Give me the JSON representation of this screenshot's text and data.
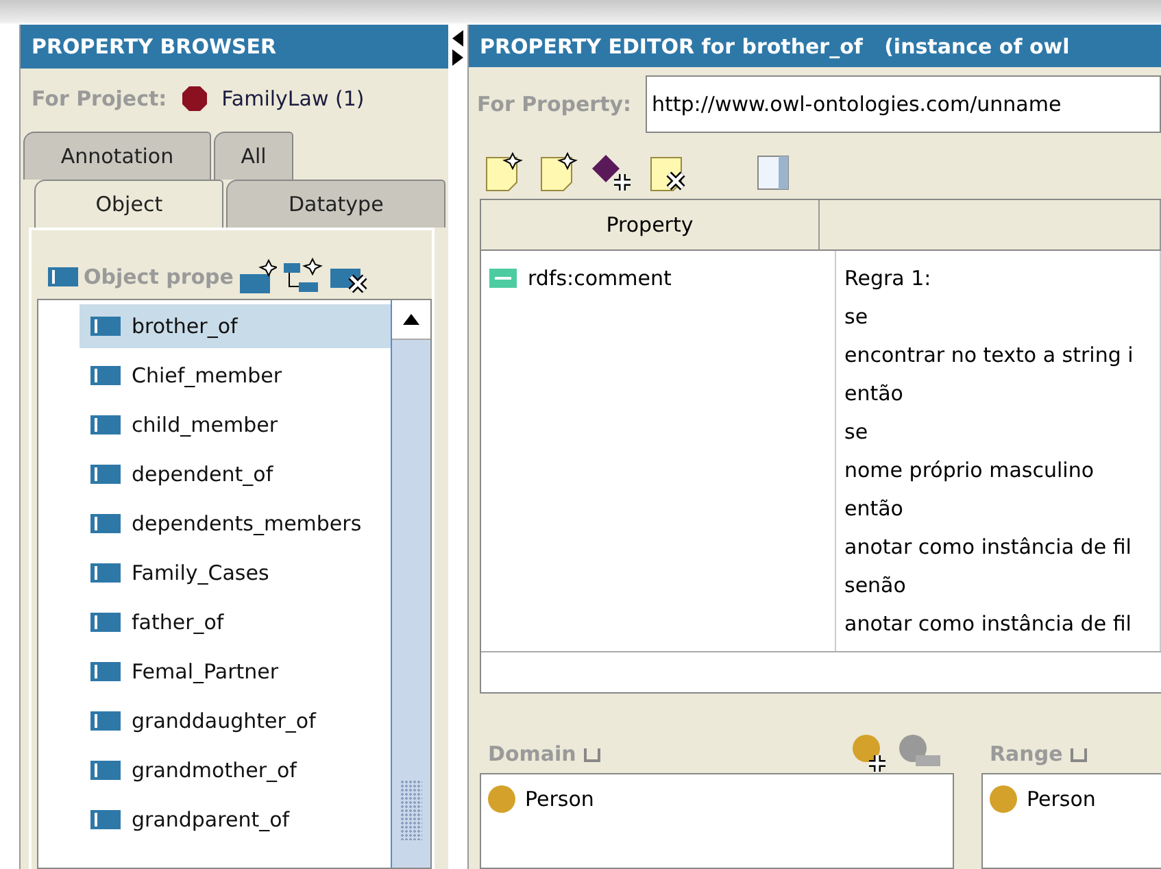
{
  "browser": {
    "title": "PROPERTY BROWSER",
    "project_label": "For Project:",
    "project": "FamilyLaw (1)",
    "tab_rows": [
      {
        "tabs": [
          {
            "label": "Annotation",
            "selected": false
          },
          {
            "label": "All",
            "selected": false
          }
        ]
      },
      {
        "tabs": [
          {
            "label": "Object",
            "selected": true
          },
          {
            "label": "Datatype",
            "selected": false
          }
        ]
      }
    ],
    "list_title": "Object prope",
    "items": [
      {
        "label": "brother_of",
        "selected": true
      },
      {
        "label": "Chief_member",
        "selected": false
      },
      {
        "label": "child_member",
        "selected": false
      },
      {
        "label": "dependent_of",
        "selected": false
      },
      {
        "label": "dependents_members",
        "selected": false
      },
      {
        "label": "Family_Cases",
        "selected": false
      },
      {
        "label": "father_of",
        "selected": false
      },
      {
        "label": "Femal_Partner",
        "selected": false
      },
      {
        "label": "granddaughter_of",
        "selected": false
      },
      {
        "label": "grandmother_of",
        "selected": false
      },
      {
        "label": "grandparent_of",
        "selected": false
      }
    ]
  },
  "editor": {
    "title": "PROPERTY EDITOR for brother_of   (instance of owl",
    "property_label": "For Property:",
    "property_uri": "http://www.owl-ontologies.com/unname",
    "table": {
      "columns": [
        "Property"
      ],
      "rows": [
        {
          "property": "rdfs:comment",
          "value_lines": [
            "Regra 1:",
            "se",
            "encontrar no texto a string i",
            "então",
            "se",
            "nome próprio masculino",
            "então",
            "anotar como instância de fil",
            "senão",
            "anotar como instância de fil"
          ]
        }
      ]
    },
    "domain": {
      "label": "Domain",
      "items": [
        "Person"
      ]
    },
    "range": {
      "label": "Range",
      "items": [
        "Person"
      ]
    }
  }
}
